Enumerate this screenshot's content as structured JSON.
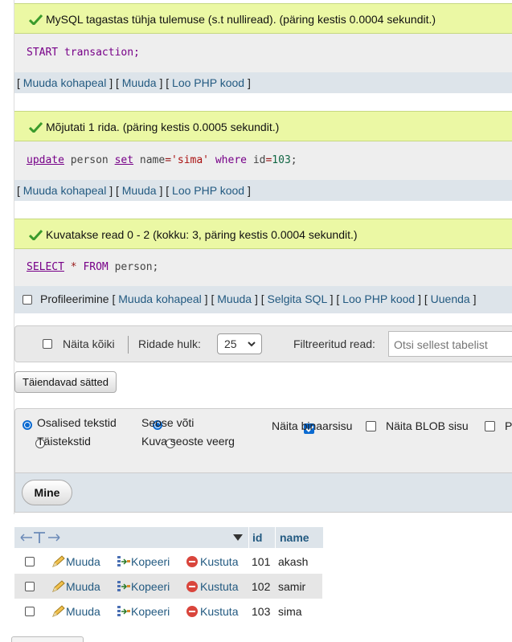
{
  "results": [
    {
      "message": "MySQL tagastas tühja tulemuse (s.t nulliread). (päring kestis 0.0004 sekundit.)",
      "sql": [
        "START transaction;"
      ],
      "links": [
        "Muuda kohapeal",
        "Muuda",
        "Loo PHP kood"
      ]
    },
    {
      "message": "Mõjutati 1 rida. (päring kestis 0.0005 sekundit.)",
      "sql": [
        "update",
        "person",
        "set",
        "name",
        "=",
        "'sima'",
        "where",
        "id",
        "=",
        "103",
        ";"
      ],
      "links": [
        "Muuda kohapeal",
        "Muuda",
        "Loo PHP kood"
      ]
    },
    {
      "message": "Kuvatakse read 0 - 2 (kokku: 3, päring kestis 0.0004 sekundit.)",
      "sql": [
        "SELECT",
        "*",
        "FROM",
        "person;"
      ],
      "profiling_label": "Profileerimine",
      "links": [
        "Muuda kohapeal",
        "Muuda",
        "Selgita SQL",
        "Loo PHP kood",
        "Uuenda"
      ]
    }
  ],
  "navigation": {
    "show_all_label": "Näita kõiki",
    "rows_label": "Ridade hulk:",
    "rows_value": "25",
    "filter_label": "Filtreeritud read:",
    "filter_placeholder": "Otsi sellest tabelist"
  },
  "extra_options_button": "Täiendavad sätted",
  "options": {
    "partial_text": "Osalised tekstid",
    "full_text": "Täistekstid",
    "relational_key": "Seose võti",
    "relational_column": "Kuva seoste veerg",
    "show_binary": "Näita binaarsisu",
    "show_blob": "Näita BLOB sisu",
    "cut_off_label": "P"
  },
  "go_button": "Mine",
  "table": {
    "columns": [
      "id",
      "name"
    ],
    "actions": {
      "edit": "Muuda",
      "copy": "Kopeeri",
      "delete": "Kustuta"
    },
    "rows": [
      {
        "id": "101",
        "name": "akash"
      },
      {
        "id": "102",
        "name": "samir"
      },
      {
        "id": "103",
        "name": "sima"
      }
    ]
  },
  "colors": {
    "success_bg": "#ebf8a4",
    "link": "#235a81",
    "sql_keyword": "#770088",
    "checkbox_accent": "#0b6ad1"
  }
}
